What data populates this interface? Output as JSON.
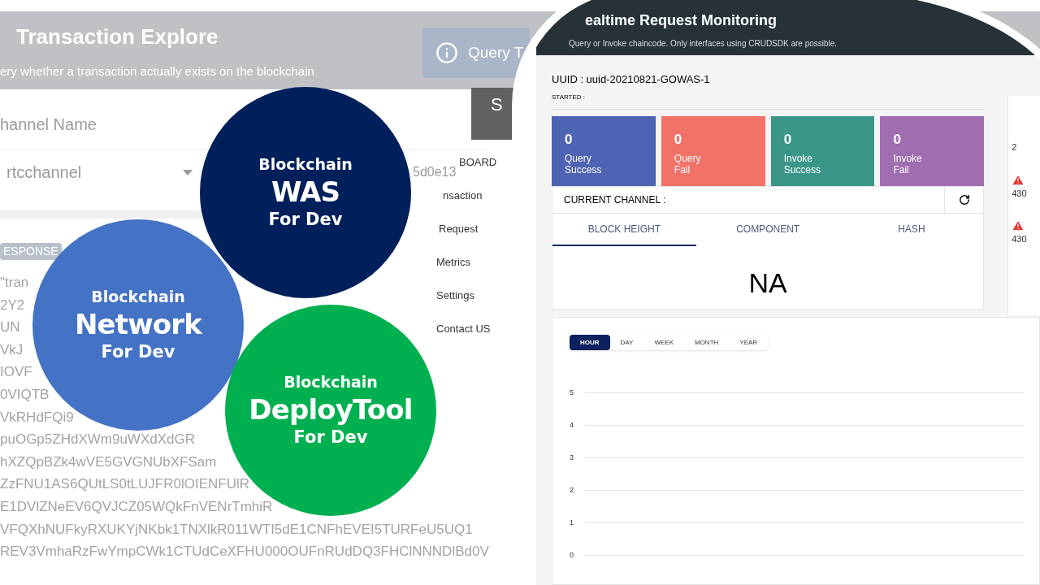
{
  "background_page": {
    "title": "Transaction Explore",
    "subtitle": "ery whether a transaction actually exists on the blockchain",
    "query_button": "Query T",
    "channel_label": "hannel Name",
    "channel_value": "rtcchannel",
    "tx_id": "5d0e13",
    "response_badge": "ESPONSE",
    "response_lines": [
      "\"tran",
      "2Y2",
      "UN",
      "VkJ",
      "IOVF",
      "0VIQTB",
      "VkRHdFQi9",
      "puOGp5ZHdXWm9uWXdXdGR",
      "hXZQpBZk4wVE5GVGNUbXFSam",
      "ZzFNU1AS6QUtLS0tLUJFR0lOIENFUlR",
      "E1DVlZNeEV6QVJCZ05WQkFnVENrTmhiR",
      "VFQXhNUFkyRXUKYjNKbk1TNXlkR011WTI5dE1CNFhEVEI5TURFeU5UQ1",
      "REV3VmhaRzFwYmpCWk1CTUdCeXFHU000OUFnRUdDQ3FHClNNNDlBd0V"
    ]
  },
  "side_menu": {
    "header": "S",
    "items": [
      {
        "label": "BOARD",
        "selected": false
      },
      {
        "label": "nsaction",
        "selected": false
      },
      {
        "label": "Request",
        "selected": false
      },
      {
        "label": "Metrics",
        "selected": false
      },
      {
        "label": "Settings",
        "selected": false
      },
      {
        "label": "Contact US",
        "selected": false
      }
    ]
  },
  "products": [
    {
      "line1": "Blockchain",
      "line2": "WAS",
      "line3": "For Dev",
      "color": "#00205b"
    },
    {
      "line1": "Blockchain",
      "line2": "Network",
      "line3": "For Dev",
      "color": "#4472c4"
    },
    {
      "line1": "Blockchain",
      "line2": "DeployTool",
      "line3": "For Dev",
      "color": "#00b050"
    }
  ],
  "monitor": {
    "title": "ealtime Request Monitoring",
    "subtitle": "Query or Invoke chaincode. Only interfaces using CRUDSDK are possible.",
    "uuid": "UUID : uuid-20210821-GOWAS-1",
    "started": "STARTED :",
    "stats": [
      {
        "value": "0",
        "line1": "Query",
        "line2": "Success",
        "color": "#4d63b3"
      },
      {
        "value": "0",
        "line1": "Query",
        "line2": "Fail",
        "color": "#f27268"
      },
      {
        "value": "0",
        "line1": "Invoke",
        "line2": "Success",
        "color": "#3a9787"
      },
      {
        "value": "0",
        "line1": "Invoke",
        "line2": "Fail",
        "color": "#a06db0"
      }
    ],
    "current_channel": "CURRENT CHANNEL :",
    "tabs": [
      {
        "label": "BLOCK HEIGHT",
        "selected": true
      },
      {
        "label": "COMPONENT",
        "selected": false
      },
      {
        "label": "HASH",
        "selected": false
      }
    ],
    "block_value": "NA",
    "periods": [
      {
        "label": "HOUR",
        "selected": true
      },
      {
        "label": "DAY",
        "selected": false
      },
      {
        "label": "WEEK",
        "selected": false
      },
      {
        "label": "MONTH",
        "selected": false
      },
      {
        "label": "YEAR",
        "selected": false
      }
    ],
    "axis_labels": [
      "5",
      "4",
      "3",
      "2",
      "1",
      "0"
    ],
    "side_panel": {
      "text": "2",
      "alerts": [
        "430",
        "430"
      ]
    }
  }
}
